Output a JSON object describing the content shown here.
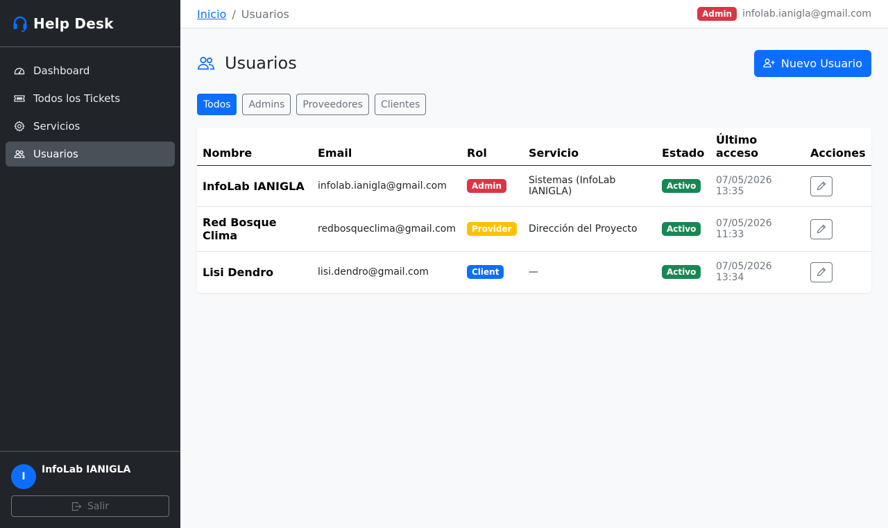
{
  "app": {
    "title": "Help Desk"
  },
  "sidebar": {
    "items": [
      {
        "label": "Dashboard",
        "icon": "speedometer-icon"
      },
      {
        "label": "Todos los Tickets",
        "icon": "ticket-icon"
      },
      {
        "label": "Servicios",
        "icon": "gear-icon"
      },
      {
        "label": "Usuarios",
        "icon": "people-icon",
        "active": true
      }
    ],
    "user": {
      "initial": "I",
      "name": "InfoLab IANIGLA"
    },
    "logout_label": "Salir"
  },
  "topbar": {
    "breadcrumb": {
      "home": "Inicio",
      "separator": "/",
      "current": "Usuarios"
    },
    "role_badge": "Admin",
    "email": "infolab.ianigla@gmail.com"
  },
  "page": {
    "title": "Usuarios",
    "new_button": "Nuevo Usuario",
    "filters": [
      {
        "label": "Todos",
        "active": true
      },
      {
        "label": "Admins",
        "active": false
      },
      {
        "label": "Proveedores",
        "active": false
      },
      {
        "label": "Clientes",
        "active": false
      }
    ]
  },
  "table": {
    "headers": [
      "Nombre",
      "Email",
      "Rol",
      "Servicio",
      "Estado",
      "Último acceso",
      "Acciones"
    ],
    "rows": [
      {
        "name": "InfoLab IANIGLA",
        "email": "infolab.ianigla@gmail.com",
        "role": "Admin",
        "role_color": "#dc3545",
        "service": "Sistemas (InfoLab IANIGLA)",
        "status": "Activo",
        "last_access_date": "07/05/2026",
        "last_access_time": "13:35"
      },
      {
        "name": "Red Bosque Clima",
        "email": "redbosqueclima@gmail.com",
        "role": "Provider",
        "role_color": "#ffc107",
        "service": "Dirección del Proyecto",
        "status": "Activo",
        "last_access_date": "07/05/2026",
        "last_access_time": "11:33"
      },
      {
        "name": "Lisi Dendro",
        "email": "lisi.dendro@gmail.com",
        "role": "Client",
        "role_color": "#0d6efd",
        "service": "—",
        "status": "Activo",
        "last_access_date": "07/05/2026",
        "last_access_time": "13:34"
      }
    ]
  },
  "colors": {
    "primary": "#0d6efd",
    "danger": "#dc3545",
    "warning": "#ffc107",
    "success": "#198754",
    "sidebar_bg": "#212529"
  }
}
